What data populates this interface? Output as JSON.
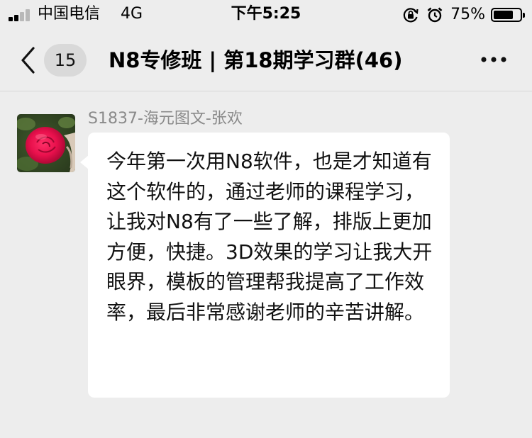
{
  "status_bar": {
    "carrier": "中国电信",
    "network": "4G",
    "time": "下午5:25",
    "battery_percent": "75%",
    "battery_level": 0.75,
    "signal_bars": 2,
    "icons": [
      "orientation-lock-icon",
      "alarm-clock-icon"
    ]
  },
  "nav": {
    "unread_count": "15",
    "title": "N8专修班 | 第18期学习群(46)"
  },
  "message": {
    "sender": "S1837-海元图文-张欢",
    "text": "今年第一次用N8软件，也是才知道有这个软件的，通过老师的课程学习，让我对N8有了一些了解，排版上更加方便，快捷。3D效果的学习让我大开眼界，模板的管理帮我提高了工作效率，最后非常感谢老师的辛苦讲解。"
  },
  "colors": {
    "background": "#ededed",
    "bubble": "#ffffff",
    "sender_name": "#8a8a8a",
    "unread_badge": "#d9d9d9"
  }
}
